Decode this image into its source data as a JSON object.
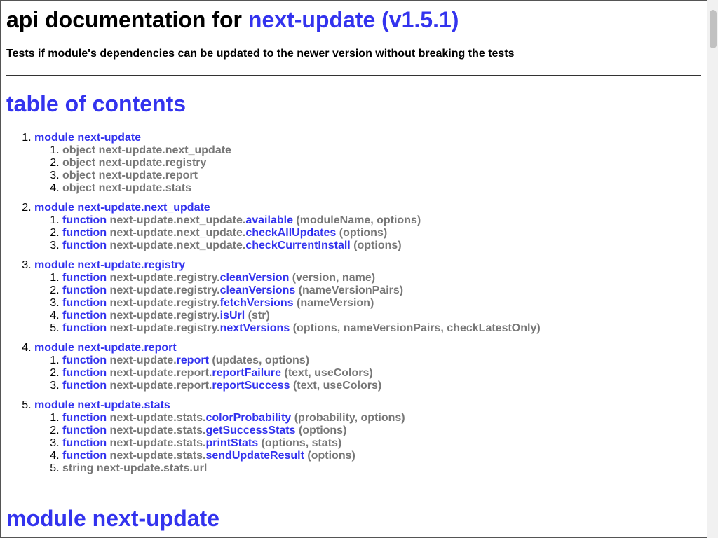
{
  "header": {
    "title_prefix": "api documentation for ",
    "title_link": "next-update (v1.5.1)",
    "description": "Tests if module's dependencies can be updated to the newer version without breaking the tests"
  },
  "toc": {
    "heading": "table of contents",
    "modules": [
      {
        "label": "module next-update",
        "items": [
          {
            "kind": "object",
            "prefix": "next-update.next_update",
            "name": "",
            "params": ""
          },
          {
            "kind": "object",
            "prefix": "next-update.registry",
            "name": "",
            "params": ""
          },
          {
            "kind": "object",
            "prefix": "next-update.report",
            "name": "",
            "params": ""
          },
          {
            "kind": "object",
            "prefix": "next-update.stats",
            "name": "",
            "params": ""
          }
        ]
      },
      {
        "label": "module next-update.next_update",
        "items": [
          {
            "kind": "function",
            "prefix": "next-update.next_update.",
            "name": "available",
            "params": "(moduleName, options)"
          },
          {
            "kind": "function",
            "prefix": "next-update.next_update.",
            "name": "checkAllUpdates",
            "params": "(options)"
          },
          {
            "kind": "function",
            "prefix": "next-update.next_update.",
            "name": "checkCurrentInstall",
            "params": "(options)"
          }
        ]
      },
      {
        "label": "module next-update.registry",
        "items": [
          {
            "kind": "function",
            "prefix": "next-update.registry.",
            "name": "cleanVersion",
            "params": "(version, name)"
          },
          {
            "kind": "function",
            "prefix": "next-update.registry.",
            "name": "cleanVersions",
            "params": "(nameVersionPairs)"
          },
          {
            "kind": "function",
            "prefix": "next-update.registry.",
            "name": "fetchVersions",
            "params": "(nameVersion)"
          },
          {
            "kind": "function",
            "prefix": "next-update.registry.",
            "name": "isUrl",
            "params": "(str)"
          },
          {
            "kind": "function",
            "prefix": "next-update.registry.",
            "name": "nextVersions",
            "params": "(options, nameVersionPairs, checkLatestOnly)"
          }
        ]
      },
      {
        "label": "module next-update.report",
        "items": [
          {
            "kind": "function",
            "prefix": "next-update.",
            "name": "report",
            "params": "(updates, options)"
          },
          {
            "kind": "function",
            "prefix": "next-update.report.",
            "name": "reportFailure",
            "params": "(text, useColors)"
          },
          {
            "kind": "function",
            "prefix": "next-update.report.",
            "name": "reportSuccess",
            "params": "(text, useColors)"
          }
        ]
      },
      {
        "label": "module next-update.stats",
        "items": [
          {
            "kind": "function",
            "prefix": "next-update.stats.",
            "name": "colorProbability",
            "params": "(probability, options)"
          },
          {
            "kind": "function",
            "prefix": "next-update.stats.",
            "name": "getSuccessStats",
            "params": "(options)"
          },
          {
            "kind": "function",
            "prefix": "next-update.stats.",
            "name": "printStats",
            "params": "(options, stats)"
          },
          {
            "kind": "function",
            "prefix": "next-update.stats.",
            "name": "sendUpdateResult",
            "params": "(options)"
          },
          {
            "kind": "string",
            "prefix": "next-update.stats.url",
            "name": "",
            "params": ""
          }
        ]
      }
    ]
  },
  "section": {
    "heading": "module next-update"
  },
  "colors": {
    "link": "#3333ee",
    "muted": "#777777"
  }
}
